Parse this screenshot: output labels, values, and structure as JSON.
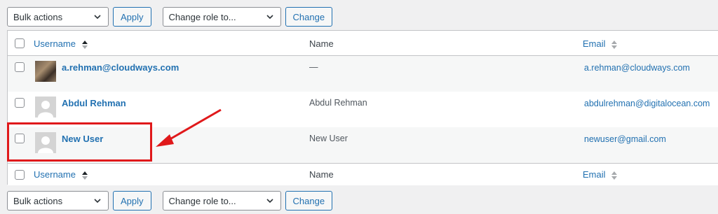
{
  "toolbar": {
    "bulk_actions": "Bulk actions",
    "apply": "Apply",
    "change_role": "Change role to...",
    "change": "Change"
  },
  "columns": {
    "username": "Username",
    "name": "Name",
    "email": "Email"
  },
  "users": [
    {
      "username": "a.rehman@cloudways.com",
      "name": "—",
      "email": "a.rehman@cloudways.com",
      "avatar": "photo"
    },
    {
      "username": "Abdul Rehman",
      "name": "Abdul Rehman",
      "email": "abdulrehman@digitalocean.com",
      "avatar": "default"
    },
    {
      "username": "New User",
      "name": "New User",
      "email": "newuser@gmail.com",
      "avatar": "default"
    }
  ],
  "colors": {
    "link": "#2271b1",
    "highlight": "#e0191b"
  },
  "annotation": {
    "highlighted_row": "New User"
  }
}
